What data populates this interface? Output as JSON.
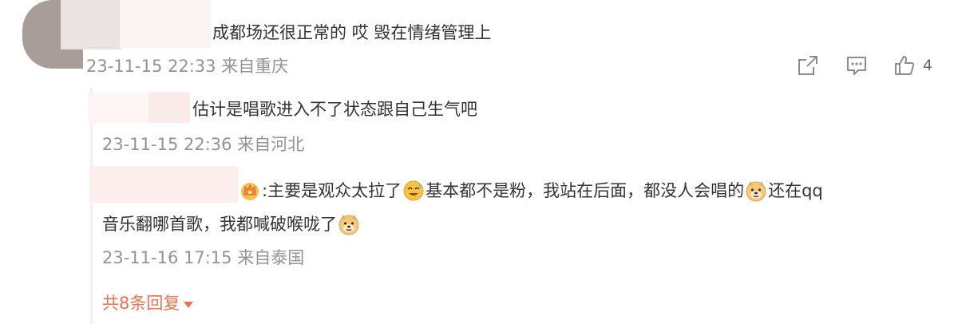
{
  "main_comment": {
    "text": "成都场还很正常的 哎 毁在情绪管理上",
    "time": "23-11-15 22:33",
    "location": "来自重庆",
    "actions": {
      "share_icon": "share-icon",
      "comment_icon": "comment-icon",
      "like_icon": "like-icon",
      "like_count": "4"
    }
  },
  "replies": [
    {
      "text": "估计是唱歌进入不了状态跟自己生气吧",
      "time": "23-11-15 22:36",
      "location": "来自河北"
    },
    {
      "prefix": ":主要是观众太拉了",
      "seg2": "基本都不是粉，我站在后面，都没人会唱的",
      "seg3": "还在qq",
      "line2": "音乐翻哪首歌，我都喊破喉咙了",
      "time": "23-11-16 17:15",
      "location": "来自泰国",
      "emojis": [
        "crown-badge-icon",
        "sweat-smile-emoji-icon",
        "doge-emoji-icon",
        "doge-emoji-icon"
      ]
    }
  ],
  "more_replies": {
    "label": "共8条回复",
    "icon": "caret-down-icon"
  },
  "colors": {
    "text": "#333333",
    "meta": "#939393",
    "accent": "#eb7350"
  }
}
